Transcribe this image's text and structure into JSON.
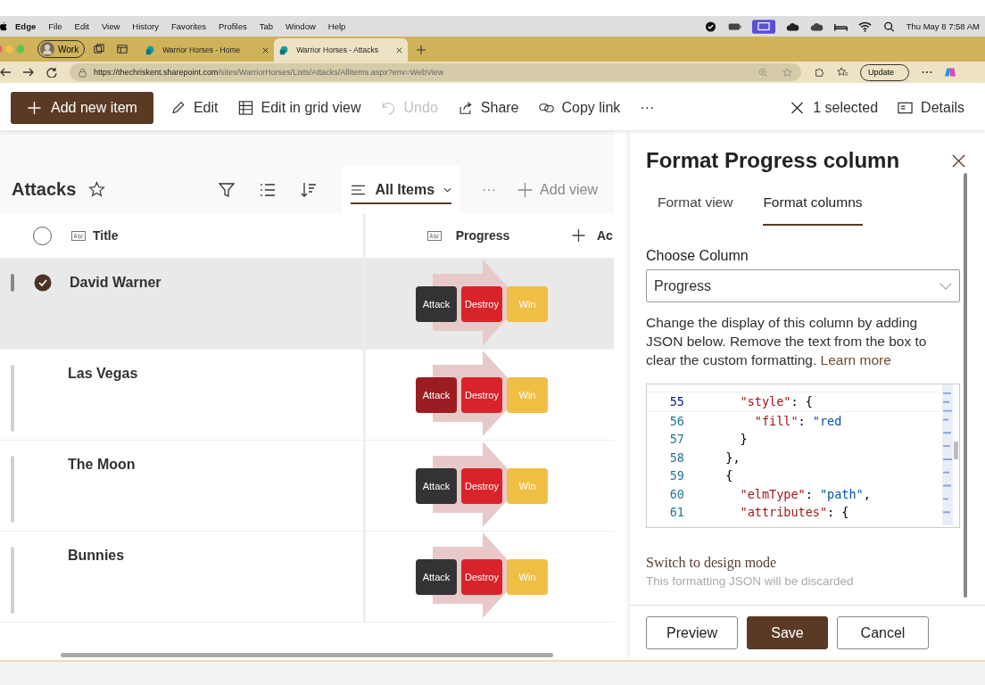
{
  "menu_bar": {
    "app": "Edge",
    "items": [
      "File",
      "Edit",
      "View",
      "History",
      "Favorites",
      "Profiles",
      "Tab",
      "Window",
      "Help"
    ],
    "clock": "Thu May 8  7:58 AM"
  },
  "browser": {
    "profile": "Work",
    "tabs": [
      {
        "title": "Warrior Horses - Home",
        "selected": false
      },
      {
        "title": "Warrior Horses - Attacks",
        "selected": true
      }
    ],
    "url_host": "https://thechriskent.sharepoint.com",
    "url_path": "/sites/WarriorHorses/Lists/Attacks/AllItems.aspx?env=WebView",
    "update": "Update"
  },
  "command_bar": {
    "add": "Add new item",
    "actions": [
      {
        "label": "Edit",
        "kind": "pencil",
        "disabled": false
      },
      {
        "label": "Edit in grid view",
        "kind": "grid",
        "disabled": false
      },
      {
        "label": "Undo",
        "kind": "undo",
        "disabled": true
      },
      {
        "label": "Share",
        "kind": "share",
        "disabled": false
      },
      {
        "label": "Copy link",
        "kind": "link",
        "disabled": false
      }
    ],
    "more": "···",
    "selection": "1 selected",
    "details": "Details"
  },
  "list": {
    "title": "Attacks",
    "views": [
      {
        "label": "All Items",
        "selected": true
      }
    ],
    "more": "···",
    "add_view": "Add view",
    "select_all": {
      "checked": false
    },
    "columns": [
      "Title",
      "Progress",
      "Ac"
    ],
    "rows": [
      {
        "title": "David Warner",
        "selected": true,
        "chips": [
          {
            "label": "Attack",
            "color": "#333333"
          },
          {
            "label": "Destroy",
            "color": "#d9232b"
          },
          {
            "label": "Win",
            "color": "#efbf45"
          }
        ]
      },
      {
        "title": "Las Vegas",
        "selected": false,
        "chips": [
          {
            "label": "Attack",
            "color": "#9b1c22"
          },
          {
            "label": "Destroy",
            "color": "#d9232b"
          },
          {
            "label": "Win",
            "color": "#efbf45"
          }
        ]
      },
      {
        "title": "The Moon",
        "selected": false,
        "chips": [
          {
            "label": "Attack",
            "color": "#333333"
          },
          {
            "label": "Destroy",
            "color": "#d9232b"
          },
          {
            "label": "Win",
            "color": "#efbf45"
          }
        ]
      },
      {
        "title": "Bunnies",
        "selected": false,
        "chips": [
          {
            "label": "Attack",
            "color": "#333333"
          },
          {
            "label": "Destroy",
            "color": "#d9232b"
          },
          {
            "label": "Win",
            "color": "#efbf45"
          }
        ]
      }
    ]
  },
  "panel": {
    "title": "Format Progress column",
    "tabs": [
      {
        "label": "Format view",
        "selected": false
      },
      {
        "label": "Format columns",
        "selected": true
      }
    ],
    "choose_label": "Choose Column",
    "column_value": "Progress",
    "description": "Change the display of this column by adding JSON below. Remove the text from the box to clear the custom formatting.",
    "learn_more": "Learn more",
    "code": [
      {
        "number": "55",
        "current": true,
        "tokens": [
          {
            "kind": "key",
            "text": "    \"style\""
          },
          {
            "kind": "punct",
            "text": ": {"
          }
        ]
      },
      {
        "number": "56",
        "current": false,
        "tokens": [
          {
            "kind": "key",
            "text": "      \"fill\""
          },
          {
            "kind": "punct",
            "text": ": "
          },
          {
            "kind": "string",
            "text": "\"red"
          }
        ]
      },
      {
        "number": "57",
        "current": false,
        "tokens": [
          {
            "kind": "punct",
            "text": "    }"
          }
        ]
      },
      {
        "number": "58",
        "current": false,
        "tokens": [
          {
            "kind": "punct",
            "text": "  },"
          }
        ]
      },
      {
        "number": "59",
        "current": false,
        "tokens": [
          {
            "kind": "punct",
            "text": "  {"
          }
        ]
      },
      {
        "number": "60",
        "current": false,
        "tokens": [
          {
            "kind": "key",
            "text": "    \"elmType\""
          },
          {
            "kind": "punct",
            "text": ": "
          },
          {
            "kind": "string",
            "text": "\"path\""
          },
          {
            "kind": "punct",
            "text": ","
          }
        ]
      },
      {
        "number": "61",
        "current": false,
        "tokens": [
          {
            "kind": "key",
            "text": "    \"attributes\""
          },
          {
            "kind": "punct",
            "text": ": {"
          }
        ]
      }
    ],
    "design_mode": "Switch to design mode",
    "design_note": "This formatting JSON will be discarded",
    "buttons": [
      {
        "label": "Preview",
        "kind": "secondary"
      },
      {
        "label": "Save",
        "kind": "primary"
      },
      {
        "label": "Cancel",
        "kind": "secondary"
      }
    ]
  }
}
